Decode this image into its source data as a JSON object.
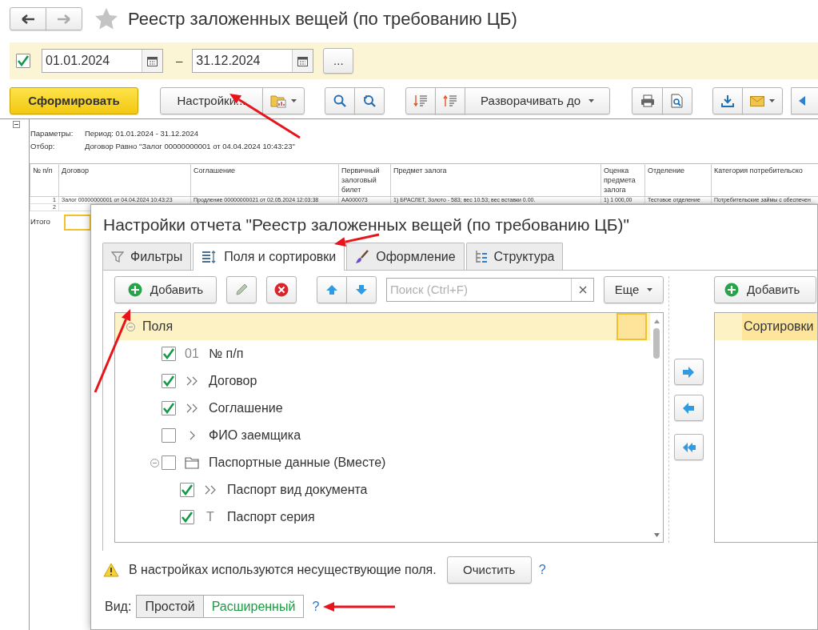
{
  "window": {
    "title": "Реестр заложенных вещей (по требованию ЦБ)"
  },
  "nav": [
    {
      "kind": "back",
      "disabled": false
    },
    {
      "kind": "forward",
      "disabled": true
    }
  ],
  "period": {
    "enabled": true,
    "from": "01.01.2024",
    "dash": "–",
    "to": "31.12.2024",
    "more": "..."
  },
  "toolbar": {
    "generate": "Сформировать",
    "settings": "Настройки...",
    "expand": "Разворачивать до"
  },
  "report": {
    "params": [
      {
        "label": "Параметры:",
        "value": "Период: 01.01.2024 - 31.12.2024"
      },
      {
        "label": "Отбор:",
        "value": "Договор Равно \"Залог 00000000001 от 04.04.2024 10:43:23\""
      }
    ],
    "columns": [
      "№ п/п",
      "Договор",
      "Соглашение",
      "Первичный залоговый билет",
      "Предмет залога",
      "Оценка предмета залога",
      "Отделение",
      "Категория потребительско"
    ],
    "rows": [
      [
        "1",
        "Залог 00000000001 от 04.04.2024 10:43:23",
        "Продление 00000000021 от 02.05.2024 12:03:38",
        "АА000073",
        "1) БРАСЛЕТ, Золото - 583; вес 10.53; вес вставки 0.00.",
        "1) 1 000,00",
        "Тестовое отделение",
        "Потребительские займы с обеспечен"
      ],
      [
        "2"
      ]
    ],
    "total": "Итого"
  },
  "dialog": {
    "title": "Настройки отчета \"Реестр заложенных вещей (по требованию ЦБ)\"",
    "tabs": [
      {
        "label": "Фильтры",
        "kind": "filter",
        "selected": false
      },
      {
        "label": "Поля и сортировки",
        "kind": "fields",
        "selected": true
      },
      {
        "label": "Оформление",
        "kind": "brush",
        "selected": false
      },
      {
        "label": "Структура",
        "kind": "structure",
        "selected": false
      }
    ],
    "add": "Добавить",
    "search": {
      "placeholder": "Поиск (Ctrl+F)"
    },
    "more": "Еще",
    "fields": {
      "title": "Поля",
      "expanded": true,
      "children": [
        {
          "label": "№ п/п",
          "kind": "number",
          "glyph": "01",
          "checked": true
        },
        {
          "label": "Договор",
          "kind": "reference",
          "checked": true
        },
        {
          "label": "Соглашение",
          "kind": "reference",
          "checked": true
        },
        {
          "label": "ФИО заемщика",
          "kind": "link",
          "checked": false
        },
        {
          "label": "Паспортные данные (Вместе)",
          "kind": "group",
          "checked": false,
          "expanded": true,
          "children": [
            {
              "label": "Паспорт вид документа",
              "kind": "reference",
              "checked": true
            },
            {
              "label": "Паспорт серия",
              "kind": "string",
              "glyph": "T",
              "checked": true
            }
          ]
        }
      ]
    },
    "sort": {
      "add": "Добавить",
      "title": "Сортировки"
    },
    "warning": "В настройках используются несуществующие поля.",
    "clear": "Очистить",
    "help": "?",
    "view": {
      "label": "Вид:",
      "options": [
        {
          "label": "Простой",
          "selected": false
        },
        {
          "label": "Расширенный",
          "selected": true
        }
      ],
      "help": "?"
    }
  }
}
